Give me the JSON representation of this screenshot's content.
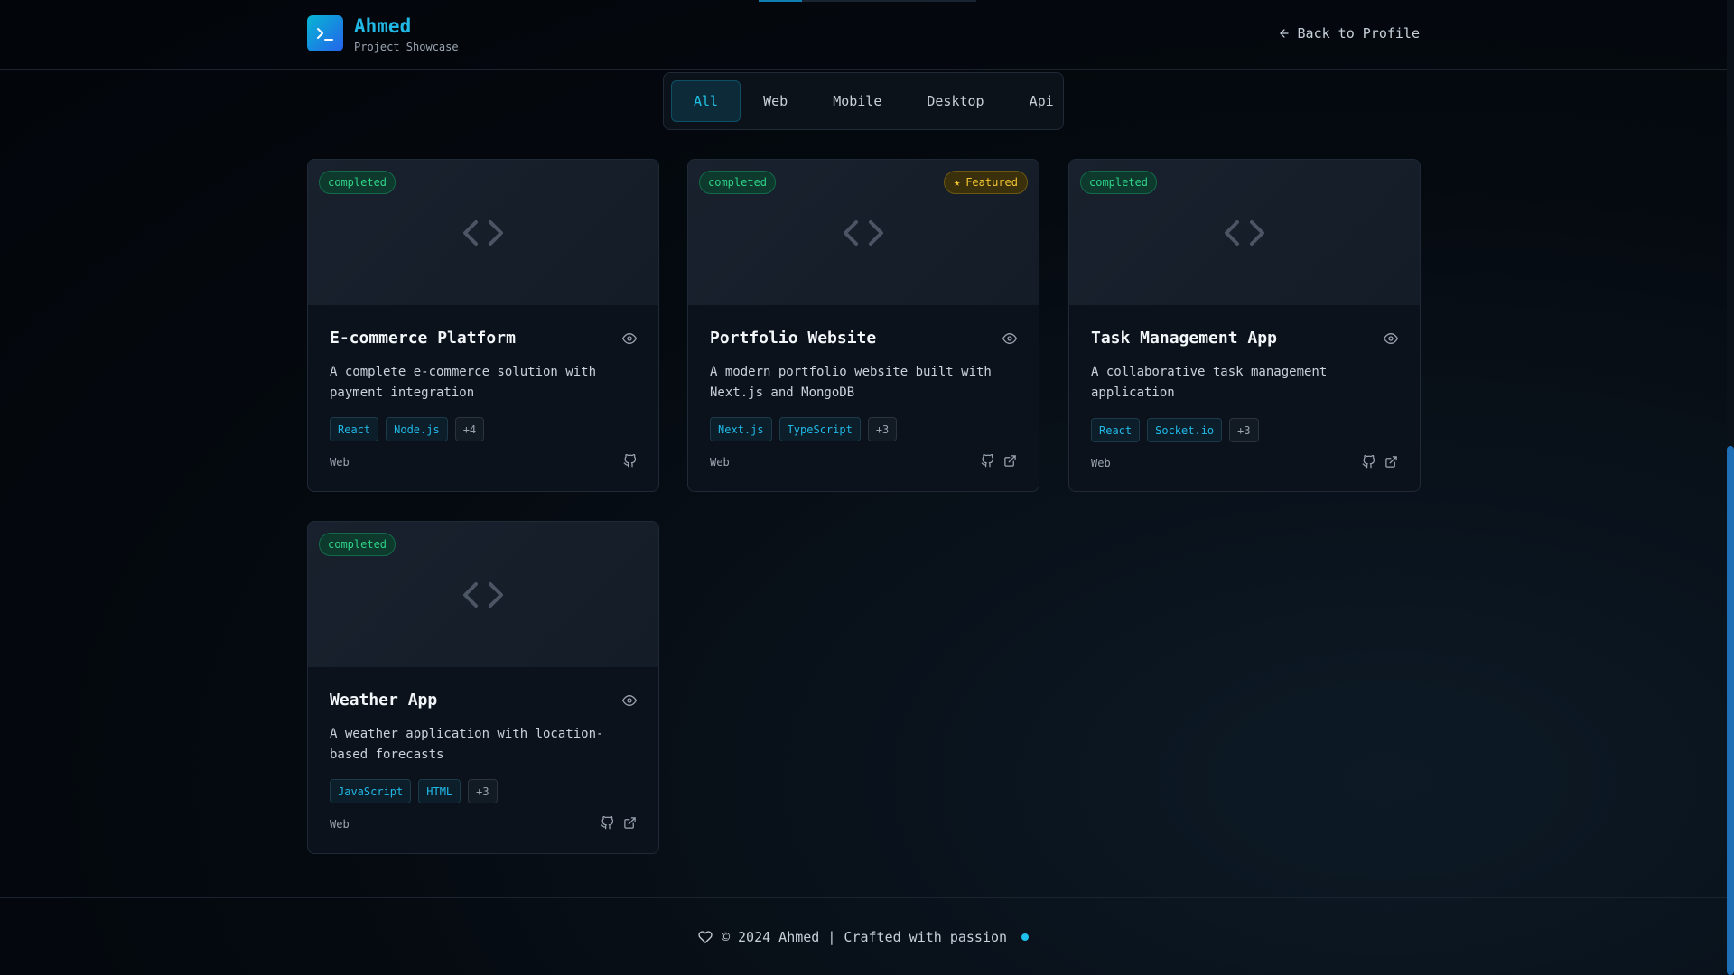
{
  "header": {
    "brand_name": "Ahmed",
    "brand_subtitle": "Project Showcase",
    "back_link": "Back to Profile"
  },
  "filters": [
    {
      "label": "All",
      "active": true
    },
    {
      "label": "Web",
      "active": false
    },
    {
      "label": "Mobile",
      "active": false
    },
    {
      "label": "Desktop",
      "active": false
    },
    {
      "label": "Api",
      "active": false
    }
  ],
  "projects": [
    {
      "status": "completed",
      "featured": false,
      "title": "E-commerce Platform",
      "description": "A complete e-commerce solution with payment integration",
      "tags": [
        "React",
        "Node.js"
      ],
      "more_tags": "+4",
      "category": "Web",
      "links": [
        "github-icon"
      ]
    },
    {
      "status": "completed",
      "featured": true,
      "featured_label": "Featured",
      "title": "Portfolio Website",
      "description": "A modern portfolio website built with Next.js and MongoDB",
      "tags": [
        "Next.js",
        "TypeScript"
      ],
      "more_tags": "+3",
      "category": "Web",
      "links": [
        "github-icon",
        "external-link-icon"
      ]
    },
    {
      "status": "completed",
      "featured": false,
      "title": "Task Management App",
      "description": "A collaborative task management application",
      "tags": [
        "React",
        "Socket.io"
      ],
      "more_tags": "+3",
      "category": "Web",
      "links": [
        "github-icon",
        "external-link-icon"
      ]
    },
    {
      "status": "completed",
      "featured": false,
      "title": "Weather App",
      "description": "A weather application with location-based forecasts",
      "tags": [
        "JavaScript",
        "HTML"
      ],
      "more_tags": "+3",
      "category": "Web",
      "links": [
        "github-icon",
        "external-link-icon"
      ]
    }
  ],
  "footer": {
    "text": "© 2024 Ahmed | Crafted with passion"
  },
  "colors": {
    "accent": "#22b8e6",
    "status_green": "#2fd38a",
    "featured_gold": "#f2c531",
    "background": "#050a10"
  }
}
